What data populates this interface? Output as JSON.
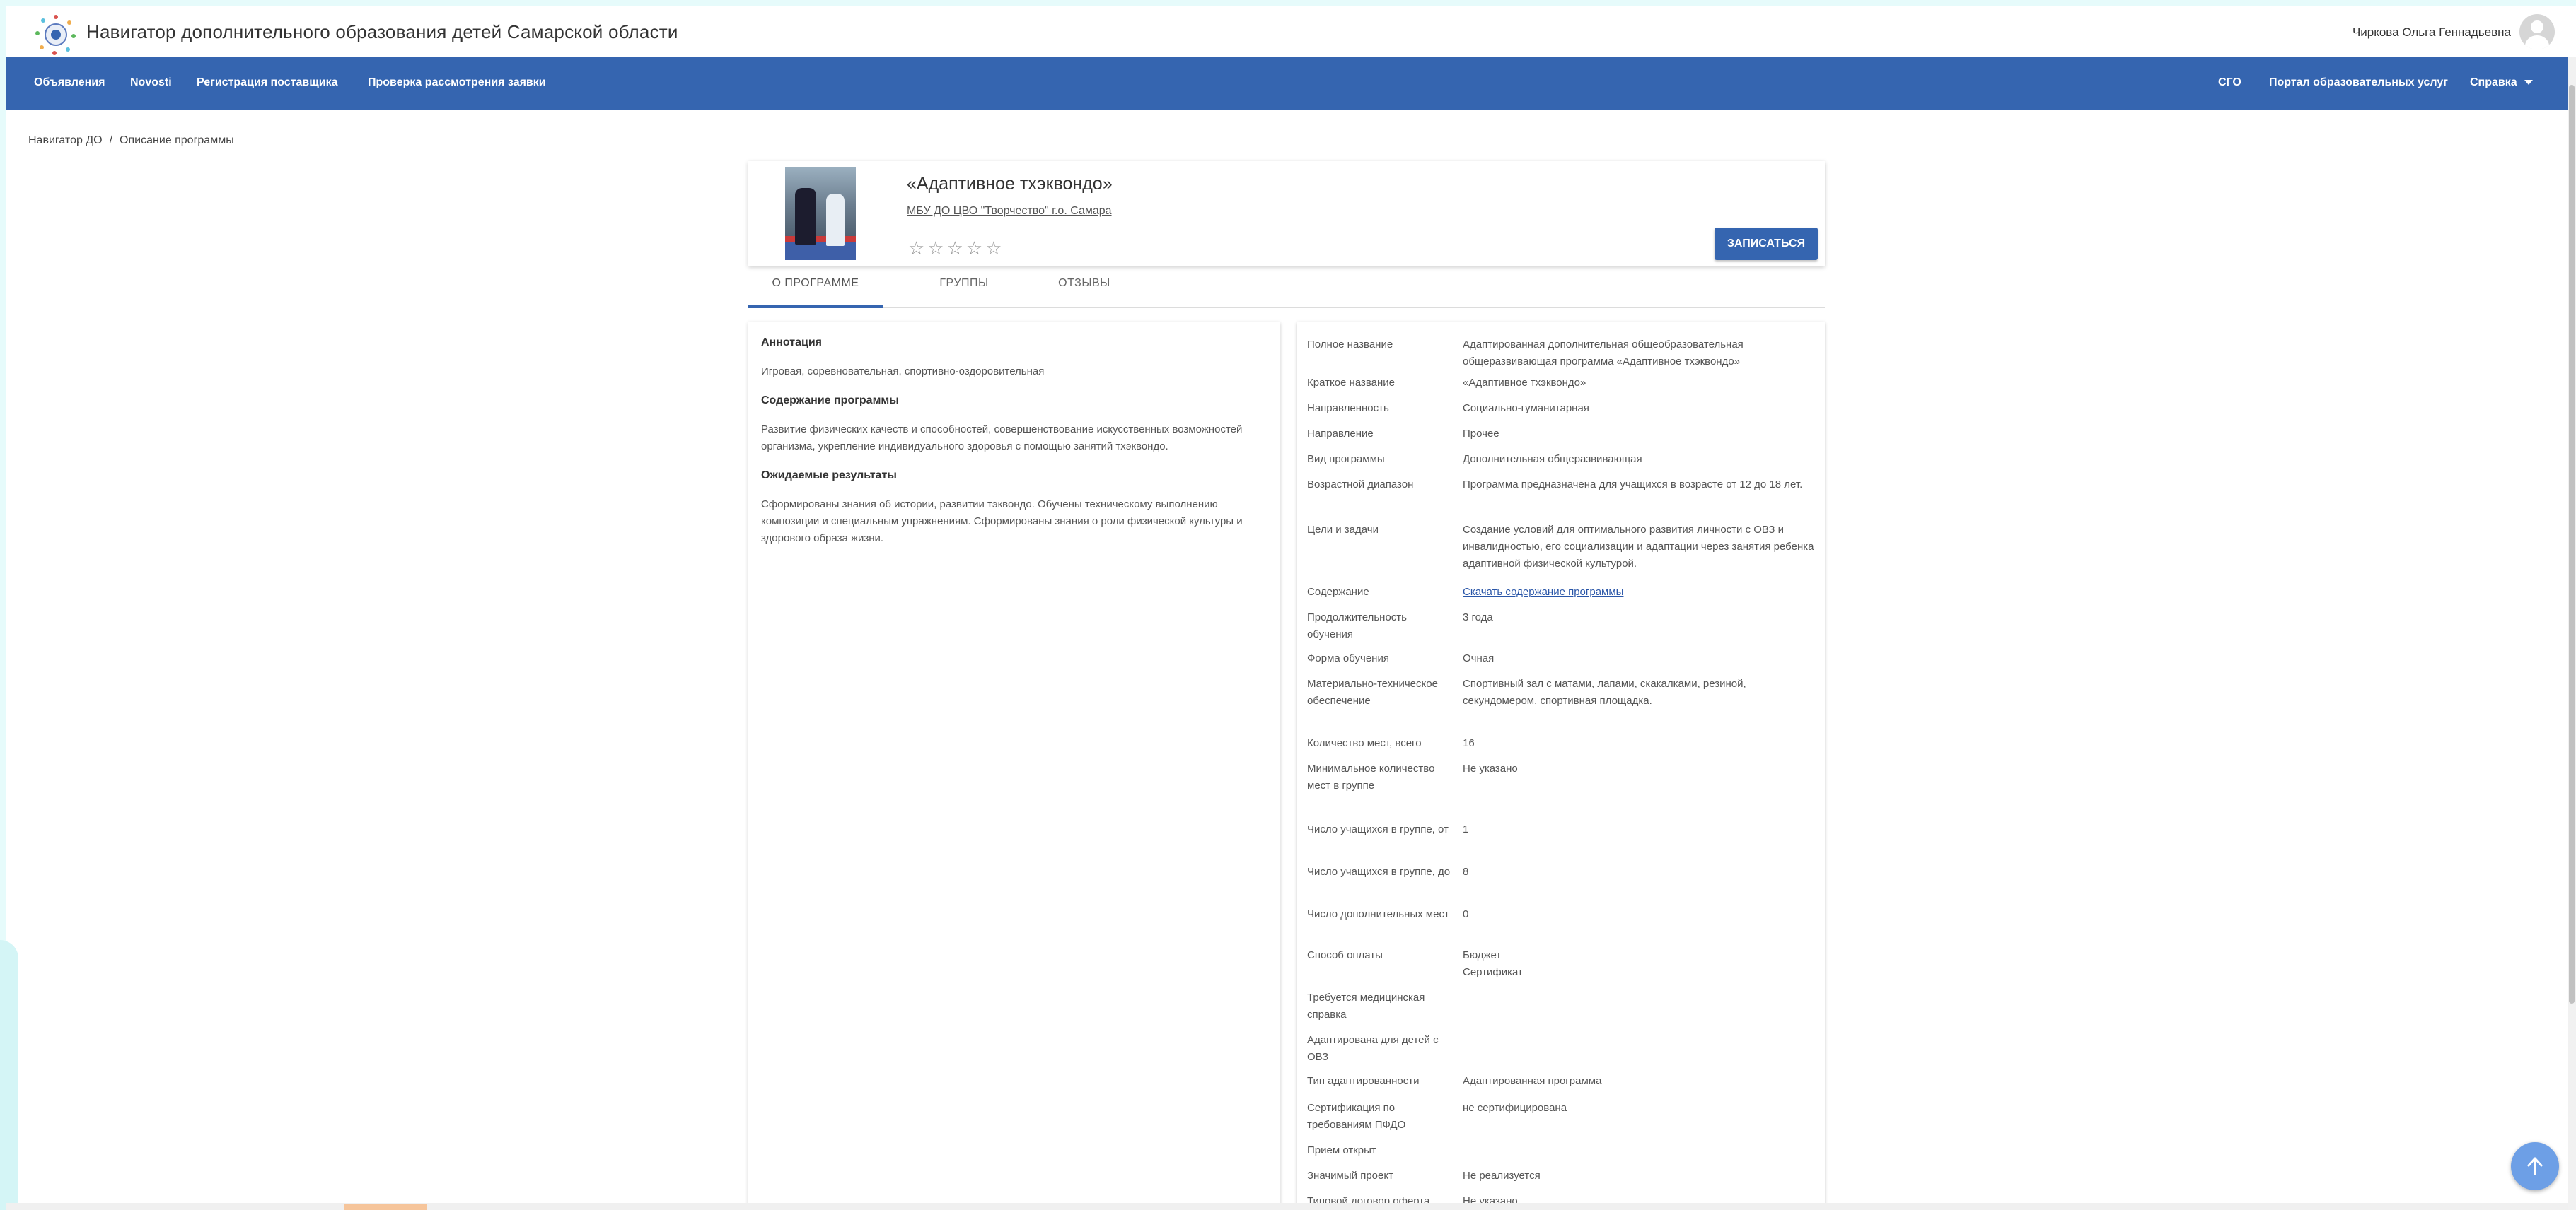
{
  "header": {
    "app_title": "Навигатор дополнительного образования детей Самарской области",
    "logo_icon": "regional-emblem-logo",
    "user_name": "Чиркова Ольга Геннадьевна",
    "avatar_icon": "user-avatar-icon"
  },
  "nav": {
    "left": [
      "Объявления",
      "Novosti",
      "Регистрация поставщика",
      "Проверка рассмотрения заявки"
    ],
    "right": [
      "СГО",
      "Портал образовательных услуг",
      "Справка"
    ],
    "color": "#3565b0"
  },
  "breadcrumb": {
    "home": "Навигатор ДО",
    "separator": "/",
    "current": "Описание программы"
  },
  "program": {
    "title": "«Адаптивное тхэквондо»",
    "organization": "МБУ ДО ЦВО \"Творчество\" г.о. Самара",
    "rating_stars": "☆☆☆☆☆",
    "rating": 0,
    "rating_max": 5,
    "enroll_label": "ЗАПИСАТЬСЯ"
  },
  "tabs": [
    {
      "label": "О ПРОГРАММЕ",
      "active": true
    },
    {
      "label": "ГРУППЫ",
      "active": false
    },
    {
      "label": "ОТЗЫВЫ",
      "active": false
    }
  ],
  "about": {
    "annotation_head": "Аннотация",
    "annotation_text": "Игровая, соревновательная, спортивно-оздоровительная",
    "content_head": "Содержание программы",
    "content_text": "Развитие физических качеств и способностей, совершенствование искусственных возможностей организма, укрепление индивидуального здоровья с помощью занятий тхэквондо.",
    "results_head": "Ожидаемые результаты",
    "results_text": "Сформированы знания об истории, развитии тэквондо. Обучены техническому выполнению композиции и специальным упражнениям. Сформированы знания о роли физической культуры и здорового образа жизни."
  },
  "details": [
    {
      "label": "Полное название",
      "value": "Адаптированная дополнительная общеобразовательная общеразвивающая программа «Адаптивное тхэквондо»"
    },
    {
      "label": "Краткое название",
      "value": "«Адаптивное тхэквондо»"
    },
    {
      "label": "Направленность",
      "value": "Социально-гуманитарная"
    },
    {
      "label": "Направление",
      "value": "Прочее"
    },
    {
      "label": "Вид программы",
      "value": "Дополнительная общеразвивающая"
    },
    {
      "label": "Возрастной диапазон",
      "value": "Программа предназначена для учащихся в возрасте от 12 до 18 лет."
    },
    {
      "label": "Цели и задачи",
      "value": "Создание условий для оптимального развития личности с ОВЗ и инвалидностью, его социализации и адаптации через занятия ребенка адаптивной физической культурой."
    },
    {
      "label": "Содержание",
      "value": "Скачать содержание программы",
      "link": true
    },
    {
      "label": "Продолжительность обучения",
      "value": "3 года"
    },
    {
      "label": "Форма обучения",
      "value": "Очная"
    },
    {
      "label": "Материально-техническое обеспечение",
      "value": "Спортивный зал с матами, лапами, скакалками, резиной, секундомером, спортивная площадка."
    },
    {
      "label": "Количество мест, всего",
      "value": "16"
    },
    {
      "label": "Минимальное количество мест в группе",
      "value": "Не указано"
    },
    {
      "label": "Число учащихся в группе, от",
      "value": "1"
    },
    {
      "label": "Число учащихся в группе, до",
      "value": "8"
    },
    {
      "label": "Число дополнительных мест",
      "value": "0"
    },
    {
      "label": "Способ оплаты",
      "value": "Бюджет\nСертификат"
    },
    {
      "label": "Требуется медицинская справка",
      "value": ""
    },
    {
      "label": "Адаптирована для детей с ОВЗ",
      "value": ""
    },
    {
      "label": "Тип адаптированности",
      "value": "Адаптированная программа"
    },
    {
      "label": "Сертификация по требованиям ПФДО",
      "value": "не сертифицирована"
    },
    {
      "label": "Прием открыт",
      "value": ""
    },
    {
      "label": "Значимый проект",
      "value": "Не реализуется"
    },
    {
      "label": "Типовой договор оферта",
      "value": "Не указано"
    }
  ],
  "scroll_top_icon": "arrow-up-icon"
}
